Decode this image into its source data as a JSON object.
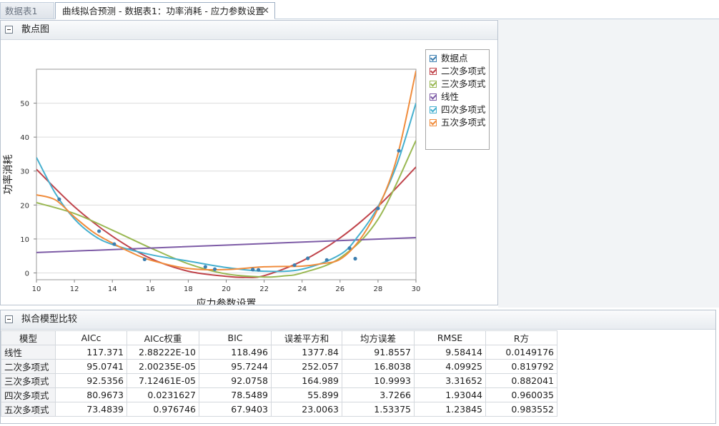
{
  "tabs": [
    {
      "label": "数据表1"
    },
    {
      "label": "曲线拟合预测 - 数据表1：功率消耗 - 应力参数设置",
      "close": "✕"
    }
  ],
  "scatter_panel": {
    "title": "散点图"
  },
  "compare_panel": {
    "title": "拟合模型比较"
  },
  "colors": {
    "points": "#3d7fb0",
    "quadratic": "#c0444b",
    "cubic": "#9ab853",
    "linear": "#7d5ba6",
    "quartic": "#46b0cf",
    "quintic": "#f08c3c"
  },
  "legend": [
    {
      "label": "数据点",
      "color": "#3d7fb0"
    },
    {
      "label": "二次多项式",
      "color": "#c0444b"
    },
    {
      "label": "三次多项式",
      "color": "#9ab853"
    },
    {
      "label": "线性",
      "color": "#7d5ba6"
    },
    {
      "label": "四次多项式",
      "color": "#46b0cf"
    },
    {
      "label": "五次多项式",
      "color": "#f08c3c"
    }
  ],
  "chart_data": {
    "type": "scatter",
    "xlabel": "应力参数设置",
    "ylabel": "功率消耗",
    "xlim": [
      10,
      30
    ],
    "ylim": [
      -2,
      60
    ],
    "x_ticks": [
      10,
      12,
      14,
      16,
      18,
      20,
      22,
      24,
      26,
      28,
      30
    ],
    "y_ticks": [
      0,
      10,
      20,
      30,
      40,
      50
    ],
    "grid": "horizontal",
    "legend_position": "right",
    "points": [
      [
        11.2,
        21.7
      ],
      [
        13.3,
        12.3
      ],
      [
        14.1,
        8.5
      ],
      [
        15.7,
        4.0
      ],
      [
        18.9,
        1.8
      ],
      [
        19.4,
        1.1
      ],
      [
        21.4,
        1.0
      ],
      [
        21.7,
        0.9
      ],
      [
        23.6,
        2.3
      ],
      [
        24.3,
        4.3
      ],
      [
        25.3,
        3.8
      ],
      [
        26.5,
        7.3
      ],
      [
        26.8,
        4.2
      ],
      [
        28.0,
        19.0
      ],
      [
        29.1,
        36.0
      ]
    ],
    "series": [
      {
        "name": "二次多项式",
        "type": "line",
        "color": "#c0444b",
        "x": [
          10,
          12,
          14,
          16,
          18,
          20,
          21,
          22,
          24,
          26,
          28,
          30
        ],
        "y": [
          30.5,
          19.5,
          10.8,
          4.3,
          0.5,
          -1.0,
          -1.3,
          -0.8,
          3.5,
          10.3,
          19.6,
          31.2
        ]
      },
      {
        "name": "三次多项式",
        "type": "line",
        "color": "#9ab853",
        "x": [
          10,
          12,
          14,
          16,
          18,
          20,
          22,
          23,
          24,
          26,
          28,
          30
        ],
        "y": [
          20.7,
          17.5,
          12.6,
          7.4,
          2.7,
          -0.3,
          -1.2,
          -0.9,
          0.0,
          4.4,
          15.8,
          39.0
        ]
      },
      {
        "name": "线性",
        "type": "line",
        "color": "#7d5ba6",
        "x": [
          10,
          30
        ],
        "y": [
          6.0,
          10.4
        ]
      },
      {
        "name": "四次多项式",
        "type": "line",
        "color": "#46b0cf",
        "x": [
          10,
          11,
          12,
          13,
          14,
          16,
          18,
          20,
          22,
          24,
          26,
          27,
          28,
          29,
          30
        ],
        "y": [
          34.0,
          23.4,
          15.9,
          11.1,
          8.4,
          5.4,
          3.5,
          1.6,
          0.5,
          1.1,
          5.4,
          11.2,
          19.5,
          32.0,
          50.0
        ]
      },
      {
        "name": "五次多项式",
        "type": "line",
        "color": "#f08c3c",
        "x": [
          10,
          11,
          12,
          13,
          14,
          15,
          16,
          18,
          20,
          22,
          24,
          25,
          26,
          27,
          28,
          29,
          30
        ],
        "y": [
          23.0,
          21.5,
          16.5,
          12.0,
          8.8,
          6.0,
          3.8,
          1.3,
          1.0,
          1.8,
          2.0,
          2.7,
          4.0,
          9.5,
          19.0,
          34.0,
          59.5
        ]
      }
    ]
  },
  "table": {
    "headers": [
      "模型",
      "AICc",
      "AICc权重",
      "BIC",
      "误差平方和",
      "均方误差",
      "RMSE",
      "R方"
    ],
    "rows": [
      [
        "线性",
        "117.371",
        "2.88222E-10",
        "118.496",
        "1377.84",
        "91.8557",
        "9.58414",
        "0.0149176"
      ],
      [
        "二次多项式",
        "95.0741",
        "2.00235E-05",
        "95.7244",
        "252.057",
        "16.8038",
        "4.09925",
        "0.819792"
      ],
      [
        "三次多项式",
        "92.5356",
        "7.12461E-05",
        "92.0758",
        "164.989",
        "10.9993",
        "3.31652",
        "0.882041"
      ],
      [
        "四次多项式",
        "80.9673",
        "0.0231627",
        "78.5489",
        "55.899",
        "3.7266",
        "1.93044",
        "0.960035"
      ],
      [
        "五次多项式",
        "73.4839",
        "0.976746",
        "67.9403",
        "23.0063",
        "1.53375",
        "1.23845",
        "0.983552"
      ]
    ]
  }
}
